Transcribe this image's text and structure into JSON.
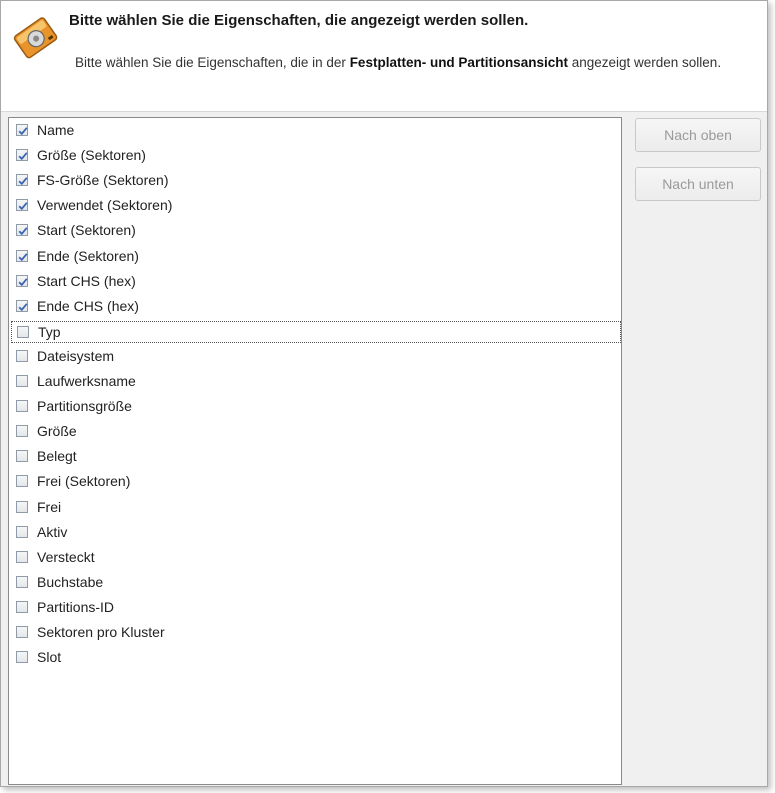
{
  "header": {
    "title": "Bitte wählen Sie die Eigenschaften, die angezeigt werden sollen.",
    "desc_pre": "Bitte wählen Sie die Eigenschaften, die in der ",
    "desc_bold": "Festplatten- und Partitionsansicht",
    "desc_post": " angezeigt werden sollen.",
    "icon": "disk-drive-icon"
  },
  "properties": [
    {
      "label": "Name",
      "checked": true
    },
    {
      "label": "Größe (Sektoren)",
      "checked": true
    },
    {
      "label": "FS-Größe (Sektoren)",
      "checked": true
    },
    {
      "label": "Verwendet (Sektoren)",
      "checked": true
    },
    {
      "label": "Start (Sektoren)",
      "checked": true
    },
    {
      "label": "Ende (Sektoren)",
      "checked": true
    },
    {
      "label": "Start CHS (hex)",
      "checked": true
    },
    {
      "label": "Ende CHS (hex)",
      "checked": true
    },
    {
      "label": "Typ",
      "checked": false,
      "focused": true
    },
    {
      "label": "Dateisystem",
      "checked": false
    },
    {
      "label": "Laufwerksname",
      "checked": false
    },
    {
      "label": "Partitionsgröße",
      "checked": false
    },
    {
      "label": "Größe",
      "checked": false
    },
    {
      "label": "Belegt",
      "checked": false
    },
    {
      "label": "Frei (Sektoren)",
      "checked": false
    },
    {
      "label": "Frei",
      "checked": false
    },
    {
      "label": "Aktiv",
      "checked": false
    },
    {
      "label": "Versteckt",
      "checked": false
    },
    {
      "label": "Buchstabe",
      "checked": false
    },
    {
      "label": "Partitions-ID",
      "checked": false
    },
    {
      "label": "Sektoren pro Kluster",
      "checked": false
    },
    {
      "label": "Slot",
      "checked": false
    }
  ],
  "buttons": {
    "up_label": "Nach oben",
    "down_label": "Nach unten",
    "enabled": false
  },
  "colors": {
    "checkmark": "#3a64b4",
    "disabled_text": "#9a9a9a"
  }
}
